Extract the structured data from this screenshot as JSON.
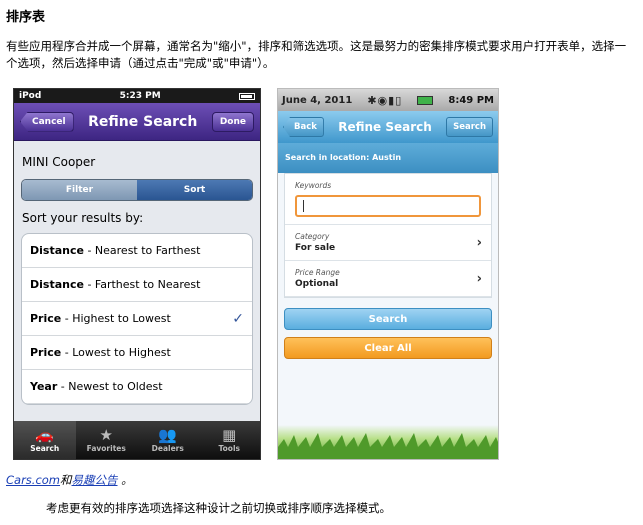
{
  "heading": "排序表",
  "intro": "有些应用程序合并成一个屏幕，通常名为\"缩小\"，排序和筛选选项。这是最努力的密集排序模式要求用户打开表单，选择一个选项，然后选择申请（通过点击\"完成\"或\"申请\"）。",
  "iphone": {
    "status": {
      "carrier": "iPod",
      "time": "5:23 PM"
    },
    "nav": {
      "cancel": "Cancel",
      "title": "Refine Search",
      "done": "Done"
    },
    "car": "MINI Cooper",
    "segments": [
      "Filter",
      "Sort"
    ],
    "sort_label": "Sort your results by:",
    "options": [
      {
        "key": "Distance",
        "desc": " - Nearest to Farthest",
        "checked": false
      },
      {
        "key": "Distance",
        "desc": " - Farthest to Nearest",
        "checked": false
      },
      {
        "key": "Price",
        "desc": " - Highest to Lowest",
        "checked": true
      },
      {
        "key": "Price",
        "desc": " - Lowest to Highest",
        "checked": false
      },
      {
        "key": "Year",
        "desc": " - Newest to Oldest",
        "checked": false
      }
    ],
    "check": "✓",
    "tabs": [
      {
        "icon": "🚗",
        "label": "Search"
      },
      {
        "icon": "★",
        "label": "Favorites"
      },
      {
        "icon": "👥",
        "label": "Dealers"
      },
      {
        "icon": "▦",
        "label": "Tools"
      }
    ]
  },
  "android": {
    "status": {
      "date": "June 4, 2011",
      "time": "8:49 PM"
    },
    "nav": {
      "back": "Back",
      "title": "Refine Search",
      "search": "Search"
    },
    "location": "Search in location: Austin",
    "keywords_label": "Keywords",
    "category": {
      "label": "Category",
      "value": "For sale"
    },
    "price": {
      "label": "Price Range",
      "value": "Optional"
    },
    "chevron": "›",
    "search_button": "Search",
    "clear_button": "Clear All"
  },
  "caption": {
    "link1": "Cars.com",
    "joiner": "和",
    "link2": "易趣公告",
    "end": "。"
  },
  "footer": "考虑更有效的排序选项选择这种设计之前切换或排序顺序选择模式。"
}
